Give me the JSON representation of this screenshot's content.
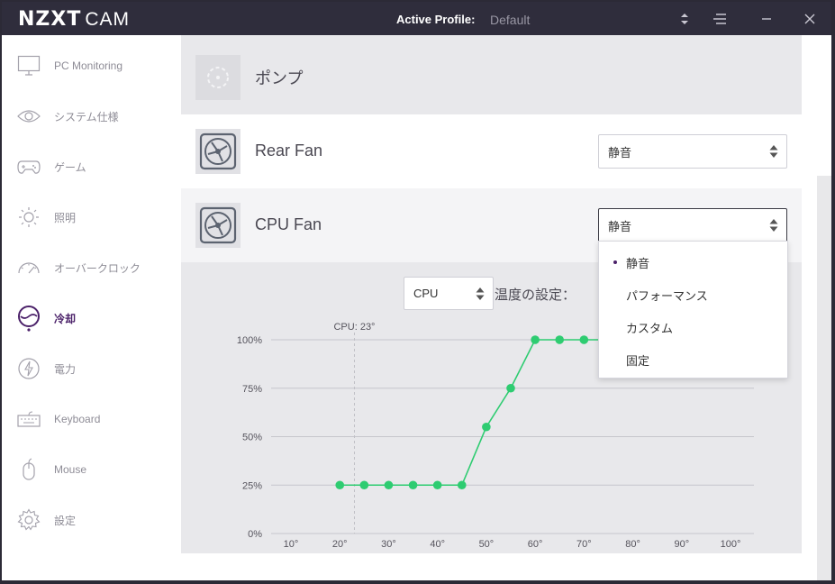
{
  "titlebar": {
    "logo_main": "NZXT",
    "logo_sub": "CAM",
    "profile_label": "Active Profile:",
    "profile_value": "Default",
    "icons": [
      "sort-arrows-icon",
      "menu-icon",
      "minimize-icon",
      "close-icon"
    ]
  },
  "sidebar": {
    "items": [
      {
        "label": "PC Monitoring",
        "icon": "monitor-icon",
        "active": false
      },
      {
        "label": "システム仕様",
        "icon": "eye-icon",
        "active": false
      },
      {
        "label": "ゲーム",
        "icon": "gamepad-icon",
        "active": false
      },
      {
        "label": "照明",
        "icon": "sun-icon",
        "active": false
      },
      {
        "label": "オーバークロック",
        "icon": "gauge-icon",
        "active": false
      },
      {
        "label": "冷却",
        "icon": "cooling-icon",
        "active": true
      },
      {
        "label": "電力",
        "icon": "power-icon",
        "active": false
      },
      {
        "label": "Keyboard",
        "icon": "keyboard-icon",
        "active": false
      },
      {
        "label": "Mouse",
        "icon": "mouse-icon",
        "active": false
      },
      {
        "label": "設定",
        "icon": "gear-icon",
        "active": false
      }
    ]
  },
  "devices": {
    "pump": {
      "title": "ポンプ",
      "icon": "pump-icon"
    },
    "rear_fan": {
      "title": "Rear Fan",
      "mode": "静音",
      "icon": "fan-icon"
    },
    "cpu_fan": {
      "title": "CPU Fan",
      "mode": "静音",
      "icon": "fan-icon"
    }
  },
  "dropdown": {
    "options": [
      "静音",
      "パフォーマンス",
      "カスタム",
      "固定"
    ],
    "selected": "静音"
  },
  "curve": {
    "source": "CPU",
    "temp_label": "温度の設定：",
    "cpu_marker": "CPU: 23°"
  },
  "colors": {
    "accent": "#4b2169",
    "curve": "#2ecc71",
    "titlebar": "#2f2d3c"
  },
  "chart_data": {
    "type": "line",
    "xlim": [
      10,
      100
    ],
    "ylim": [
      0,
      100
    ],
    "x_ticks": [
      "10°",
      "20°",
      "30°",
      "40°",
      "50°",
      "60°",
      "70°",
      "80°",
      "90°",
      "100°"
    ],
    "y_ticks": [
      "0%",
      "25%",
      "50%",
      "75%",
      "100%"
    ],
    "marker_x": 23,
    "series": [
      {
        "x": [
          20,
          25,
          30,
          35,
          40,
          45,
          50,
          55,
          60,
          65,
          70,
          75
        ],
        "y": [
          25,
          25,
          25,
          25,
          25,
          25,
          55,
          75,
          100,
          100,
          100,
          100
        ]
      }
    ]
  }
}
